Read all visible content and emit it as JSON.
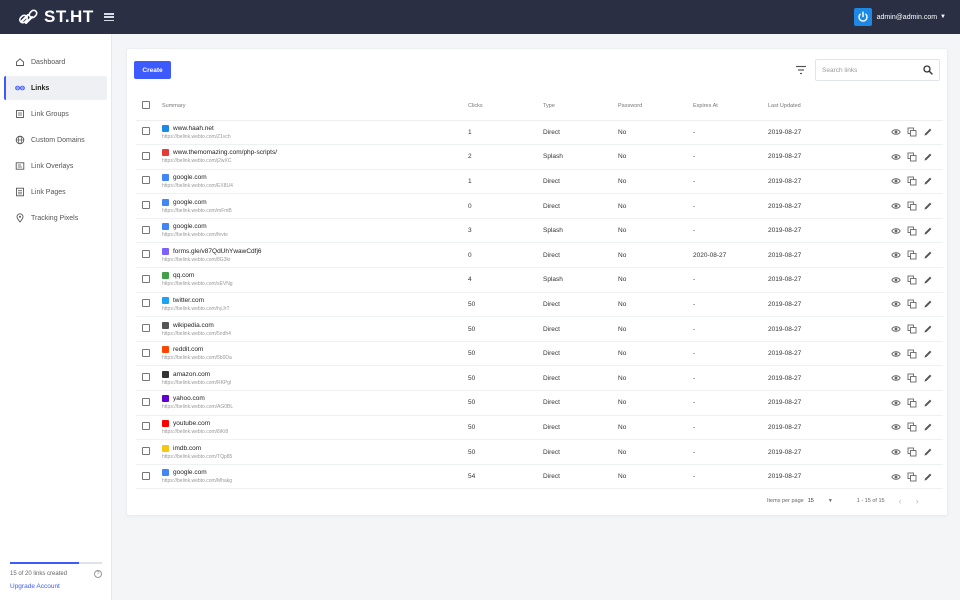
{
  "app": {
    "logo_text": "ST.HT",
    "user_email": "admin@admin.com",
    "accent": "#3d5afe",
    "topbar_color": "#2a2f44"
  },
  "sidebar": {
    "items": [
      {
        "label": "Dashboard",
        "icon": "home-icon"
      },
      {
        "label": "Links",
        "icon": "link-icon",
        "active": true
      },
      {
        "label": "Link Groups",
        "icon": "groups-icon"
      },
      {
        "label": "Custom Domains",
        "icon": "globe-icon"
      },
      {
        "label": "Link Overlays",
        "icon": "overlay-icon"
      },
      {
        "label": "Link Pages",
        "icon": "pages-icon"
      },
      {
        "label": "Tracking Pixels",
        "icon": "pin-icon"
      }
    ],
    "usage_text": "15 of 20 links created",
    "usage_fraction": 0.75,
    "upgrade_label": "Upgrade Account"
  },
  "toolbar": {
    "create_label": "Create",
    "search_placeholder": "Search links"
  },
  "table": {
    "columns": [
      "Summary",
      "Clicks",
      "Type",
      "Password",
      "Expires At",
      "Last Updated"
    ],
    "rows": [
      {
        "domain": "www.haah.net",
        "short": "https://belink.webto.com/Z1vch",
        "clicks": "1",
        "type": "Direct",
        "password": "No",
        "expires": "-",
        "updated": "2019-08-27",
        "favicon_color": "#1e88e5"
      },
      {
        "domain": "www.themomazing.com/php-scripts/",
        "short": "https://belink.webto.com/j2wXC",
        "clicks": "2",
        "type": "Splash",
        "password": "No",
        "expires": "-",
        "updated": "2019-08-27",
        "favicon_color": "#e53935"
      },
      {
        "domain": "google.com",
        "short": "https://belink.webto.com/EX8U4",
        "clicks": "1",
        "type": "Direct",
        "password": "No",
        "expires": "-",
        "updated": "2019-08-27",
        "favicon_color": "#4285f4"
      },
      {
        "domain": "google.com",
        "short": "https://belink.webto.com/mFmB",
        "clicks": "0",
        "type": "Direct",
        "password": "No",
        "expires": "-",
        "updated": "2019-08-27",
        "favicon_color": "#4285f4"
      },
      {
        "domain": "google.com",
        "short": "https://belink.webto.com/fevte",
        "clicks": "3",
        "type": "Splash",
        "password": "No",
        "expires": "-",
        "updated": "2019-08-27",
        "favicon_color": "#4285f4"
      },
      {
        "domain": "forms.gle/v87QdUhYwawCdfj6",
        "short": "https://belink.webto.com/8G3kr",
        "clicks": "0",
        "type": "Direct",
        "password": "No",
        "expires": "2020-08-27",
        "updated": "2019-08-27",
        "favicon_color": "#7b61ff"
      },
      {
        "domain": "qq.com",
        "short": "https://belink.webto.com/xEVNg",
        "clicks": "4",
        "type": "Splash",
        "password": "No",
        "expires": "-",
        "updated": "2019-08-27",
        "favicon_color": "#43a047"
      },
      {
        "domain": "twitter.com",
        "short": "https://belink.webto.com/hyJrT",
        "clicks": "50",
        "type": "Direct",
        "password": "No",
        "expires": "-",
        "updated": "2019-08-27",
        "favicon_color": "#1da1f2"
      },
      {
        "domain": "wikipedia.com",
        "short": "https://belink.webto.com/5ndh4",
        "clicks": "50",
        "type": "Direct",
        "password": "No",
        "expires": "-",
        "updated": "2019-08-27",
        "favicon_color": "#555555"
      },
      {
        "domain": "reddit.com",
        "short": "https://belink.webto.com/5b0Da",
        "clicks": "50",
        "type": "Direct",
        "password": "No",
        "expires": "-",
        "updated": "2019-08-27",
        "favicon_color": "#ff4500"
      },
      {
        "domain": "amazon.com",
        "short": "https://belink.webto.com/RKPgl",
        "clicks": "50",
        "type": "Direct",
        "password": "No",
        "expires": "-",
        "updated": "2019-08-27",
        "favicon_color": "#333333"
      },
      {
        "domain": "yahoo.com",
        "short": "https://belink.webto.com/AG0BL",
        "clicks": "50",
        "type": "Direct",
        "password": "No",
        "expires": "-",
        "updated": "2019-08-27",
        "favicon_color": "#5f01d1"
      },
      {
        "domain": "youtube.com",
        "short": "https://belink.webto.com/8iKi8",
        "clicks": "50",
        "type": "Direct",
        "password": "No",
        "expires": "-",
        "updated": "2019-08-27",
        "favicon_color": "#ff0000"
      },
      {
        "domain": "imdb.com",
        "short": "https://belink.webto.com/TQp85",
        "clicks": "50",
        "type": "Direct",
        "password": "No",
        "expires": "-",
        "updated": "2019-08-27",
        "favicon_color": "#f5c518"
      },
      {
        "domain": "google.com",
        "short": "https://belink.webto.com/Mhakg",
        "clicks": "54",
        "type": "Direct",
        "password": "No",
        "expires": "-",
        "updated": "2019-08-27",
        "favicon_color": "#4285f4"
      }
    ]
  },
  "pagination": {
    "items_per_page_label": "Items per page",
    "per_page_value": "15",
    "range_text": "1 - 15 of 15"
  }
}
